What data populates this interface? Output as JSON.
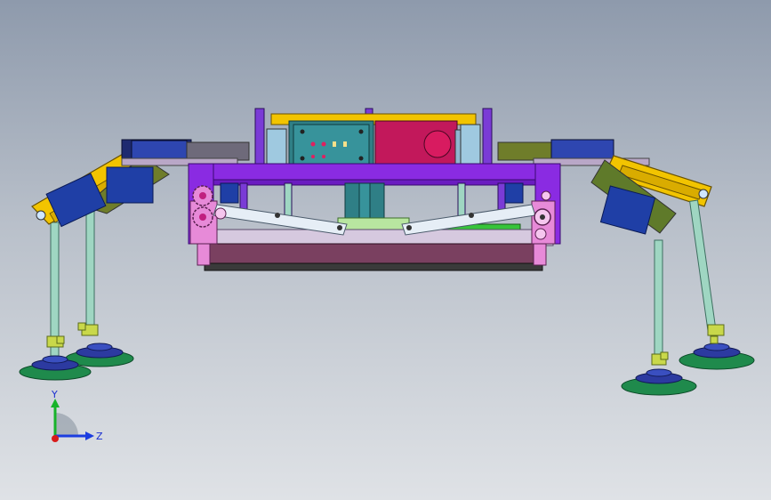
{
  "view": {
    "background_top": "#8e9aac",
    "background_bottom": "#dfe2e6"
  },
  "model_colors": {
    "frame": "#8a2be2",
    "block_teal": "#2f7f86",
    "block_magenta": "#c2185b",
    "arm_yellow": "#f2c400",
    "arm_olive": "#6f7d2a",
    "motor_blue": "#1f3fa6",
    "rod": "#9fd6c2",
    "cup_green": "#1f8a4c",
    "base_plate": "#7a4060",
    "gear_pink": "#e78ad8",
    "link_white": "#e6eef6"
  },
  "triad": {
    "y_label": "Y",
    "z_label": "Z",
    "y_color": "#17b32a",
    "z_color": "#1b3de0",
    "origin_color": "#d81b1b"
  }
}
